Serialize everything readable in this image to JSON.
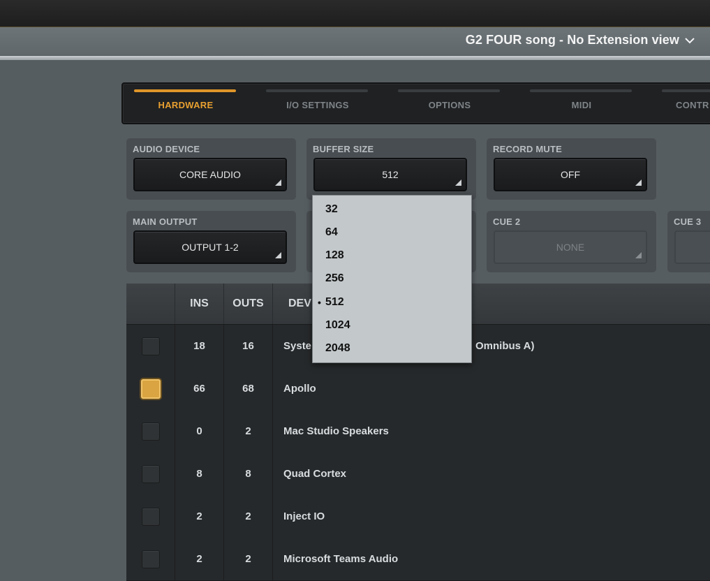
{
  "window": {
    "title": "G2 FOUR song - No Extension view"
  },
  "tabs": [
    {
      "label": "HARDWARE",
      "active": true
    },
    {
      "label": "I/O SETTINGS",
      "active": false
    },
    {
      "label": "OPTIONS",
      "active": false
    },
    {
      "label": "MIDI",
      "active": false
    },
    {
      "label": "CONTR",
      "active": false
    }
  ],
  "settings": {
    "audio_device": {
      "label": "AUDIO DEVICE",
      "value": "CORE AUDIO"
    },
    "buffer_size": {
      "label": "BUFFER SIZE",
      "value": "512"
    },
    "record_mute": {
      "label": "RECORD MUTE",
      "value": "OFF"
    },
    "main_output": {
      "label": "MAIN OUTPUT",
      "value": "OUTPUT 1-2"
    },
    "cue2": {
      "label": "CUE 2",
      "value": "NONE"
    },
    "cue3": {
      "label": "CUE 3",
      "value": ""
    }
  },
  "buffer_dropdown": {
    "options": [
      "32",
      "64",
      "128",
      "256",
      "512",
      "1024",
      "2048"
    ],
    "selected": "512",
    "selected_marker": "•"
  },
  "device_table": {
    "headers": {
      "ins": "INS",
      "outs": "OUTS",
      "device": "DEV"
    },
    "rows": [
      {
        "checked": false,
        "ins": "18",
        "outs": "16",
        "device": "Syste",
        "device_tail": "Omnibus A)"
      },
      {
        "checked": true,
        "ins": "66",
        "outs": "68",
        "device": "Apollo"
      },
      {
        "checked": false,
        "ins": "0",
        "outs": "2",
        "device": "Mac Studio Speakers"
      },
      {
        "checked": false,
        "ins": "8",
        "outs": "8",
        "device": "Quad Cortex"
      },
      {
        "checked": false,
        "ins": "2",
        "outs": "2",
        "device": "Inject IO"
      },
      {
        "checked": false,
        "ins": "2",
        "outs": "2",
        "device": "Microsoft Teams Audio"
      }
    ]
  },
  "colors": {
    "accent": "#e8a030",
    "checkbox_on": "#d9a441"
  }
}
